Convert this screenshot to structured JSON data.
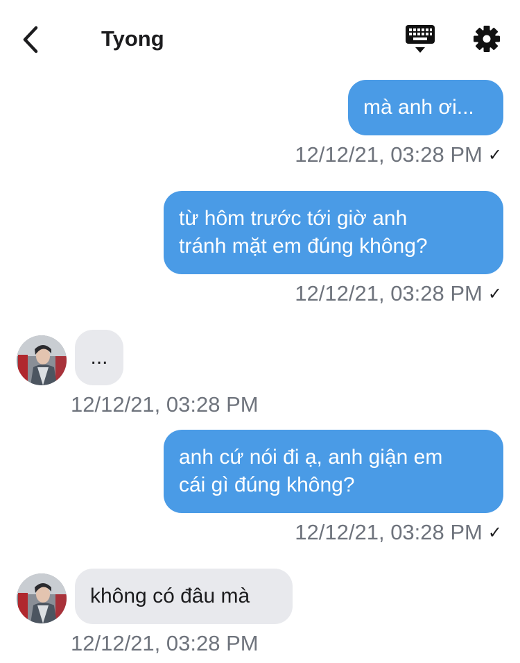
{
  "header": {
    "title": "Tyong",
    "back_icon": "chevron-left-icon",
    "keyboard_icon": "keyboard-icon",
    "settings_icon": "gear-icon"
  },
  "colors": {
    "outgoing_bubble": "#4a9be6",
    "incoming_bubble": "#e8e9ed",
    "timestamp": "#6e737c"
  },
  "messages": [
    {
      "direction": "outgoing",
      "text": "mà anh ơi...",
      "time": "12/12/21, 03:28 PM",
      "status": "✓"
    },
    {
      "direction": "outgoing",
      "text": "từ hôm trước tới giờ anh\ntránh mặt em đúng không?",
      "time": "12/12/21, 03:28 PM",
      "status": "✓"
    },
    {
      "direction": "incoming",
      "text": "...",
      "time": "12/12/21, 03:28 PM"
    },
    {
      "direction": "outgoing",
      "text": "anh cứ nói đi ạ, anh giận em\ncái gì đúng không?",
      "time": "12/12/21, 03:28 PM",
      "status": "✓"
    },
    {
      "direction": "incoming",
      "text": "không có đâu mà",
      "time": "12/12/21, 03:28 PM"
    }
  ]
}
